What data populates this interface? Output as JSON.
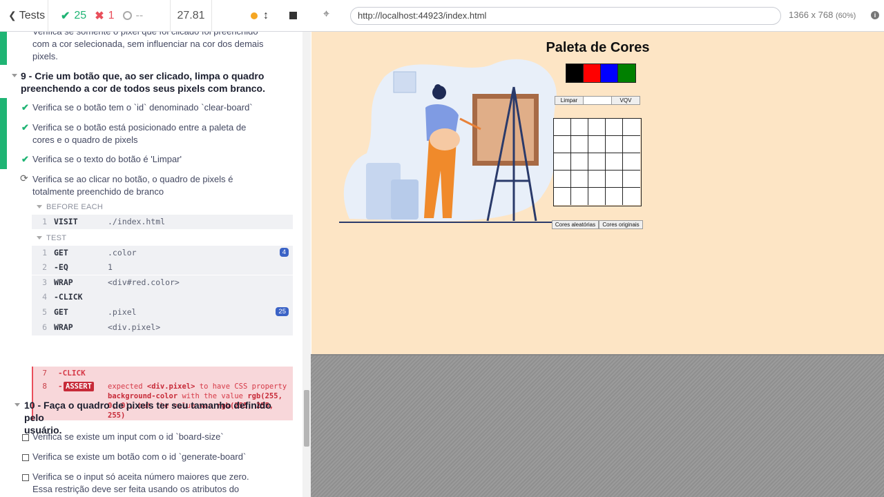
{
  "topbar": {
    "back_label": "Tests",
    "passed": "25",
    "failed": "1",
    "pending": "--",
    "duration": "27.81"
  },
  "reporter": {
    "prev_test_lines": [
      "Verifica se somente o pixel que foi clicado foi preenchido",
      "com a cor selecionada, sem influenciar na cor dos demais",
      "pixels."
    ],
    "suite9_title_lines": [
      "9 - Crie um botão que, ao ser clicado, limpa o quadro",
      "preenchendo a cor de todos seus pixels com branco."
    ],
    "suite9_tests": [
      {
        "lines": [
          "Verifica se o botão tem o `id` denominado `clear-board`"
        ]
      },
      {
        "lines": [
          "Verifica se o botão está posicionado entre a paleta de",
          "cores e o quadro de pixels"
        ]
      },
      {
        "lines": [
          "Verifica se o texto do botão é 'Limpar'"
        ]
      }
    ],
    "running_test_lines": [
      "Verifica se ao clicar no botão, o quadro de pixels é",
      "totalmente preenchido de branco"
    ],
    "before_each_label": "BEFORE EACH",
    "test_label": "TEST",
    "before_each_cmds": [
      {
        "num": "1",
        "name": "VISIT",
        "msg": "./index.html"
      }
    ],
    "test_cmds": [
      {
        "num": "1",
        "name": "GET",
        "msg": ".color",
        "badge": "4"
      },
      {
        "num": "2",
        "name": "-EQ",
        "msg": "1",
        "badge": ""
      },
      {
        "num": "3",
        "name": "WRAP",
        "msg": "<div#red.color>",
        "badge": ""
      },
      {
        "num": "4",
        "name": "-CLICK",
        "msg": "",
        "badge": ""
      },
      {
        "num": "5",
        "name": "GET",
        "msg": ".pixel",
        "badge": "25"
      },
      {
        "num": "6",
        "name": "WRAP",
        "msg": "<div.pixel>",
        "badge": ""
      }
    ],
    "fail_cmd": {
      "num7": "7",
      "name7": "-CLICK",
      "num8": "8",
      "dash8": "-",
      "assert_label": "ASSERT",
      "msg_parts": {
        "p1": "expected ",
        "b1": "<div.pixel>",
        "p2": " to have CSS property ",
        "b2": "background-color",
        "p3": " with the value ",
        "b3": "rgb(255, 0, 0)",
        "p4": ", but the value was ",
        "b4": "rgb(255, 255, 255)"
      }
    },
    "suite10_title_lines": [
      "10 - Faça o quadro de pixels ter seu tamanho definido pelo",
      "usuário."
    ],
    "suite10_tests": [
      {
        "lines": [
          "Verifica se existe um input com o id `board-size`"
        ]
      },
      {
        "lines": [
          "Verifica se existe um botão com o id `generate-board`"
        ]
      },
      {
        "lines": [
          "Verifica se o input só aceita número maiores que zero.",
          "Essa restrição deve ser feita usando os atributos do"
        ]
      }
    ]
  },
  "browser": {
    "url": "http://localhost:44923/index.html",
    "viewport": "1366 x 768",
    "scale": "(60%)"
  },
  "app": {
    "title": "Paleta de Cores",
    "palette_colors": [
      "#000000",
      "#ff0000",
      "#0000ff",
      "#008000"
    ],
    "clear_button": "Limpar",
    "vqv_button": "VQV",
    "random_button": "Cores aleatórias",
    "original_button": "Cores originais",
    "accent_bg": "#fde5c5"
  },
  "colors": {
    "pass": "#1fb474",
    "fail": "#e94f5b",
    "running": "#f5a623",
    "badge": "#3b63c6"
  }
}
